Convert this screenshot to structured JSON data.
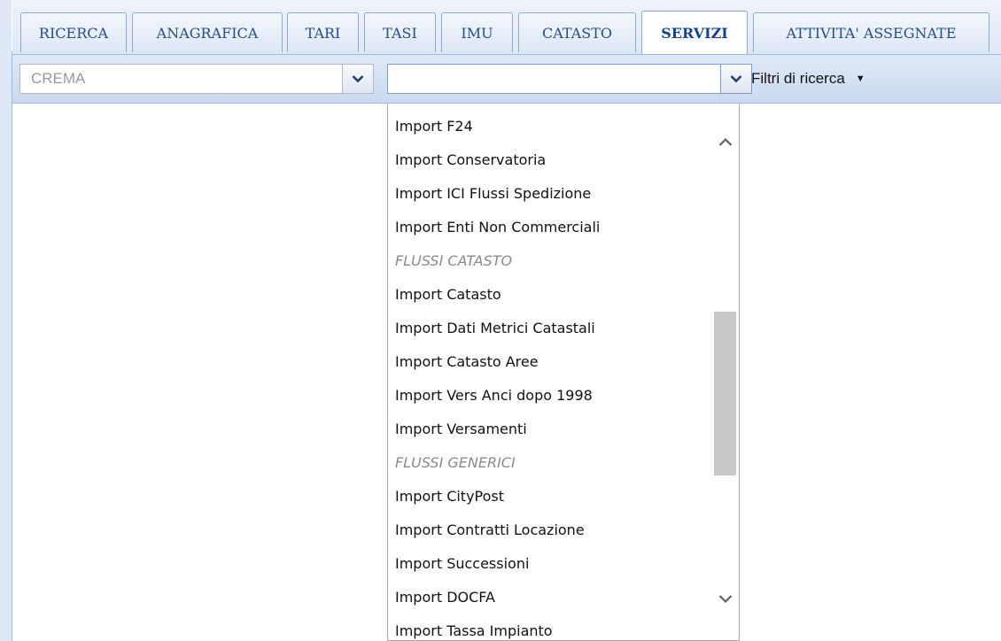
{
  "tabs": [
    {
      "label": "RICERCA"
    },
    {
      "label": "ANAGRAFICA"
    },
    {
      "label": "TARI"
    },
    {
      "label": "TASI"
    },
    {
      "label": "IMU"
    },
    {
      "label": "CATASTO"
    },
    {
      "label": "SERVIZI"
    },
    {
      "label": "ATTIVITA' ASSEGNATE"
    }
  ],
  "active_tab": "SERVIZI",
  "toolbar": {
    "municipality_value": "CREMA",
    "service_value": "",
    "filters_label": "Filtri di ricerca"
  },
  "dropdown": {
    "options": [
      {
        "label": "Import F24",
        "type": "item"
      },
      {
        "label": "Import Conservatoria",
        "type": "item"
      },
      {
        "label": "Import ICI Flussi Spedizione",
        "type": "item"
      },
      {
        "label": "Import Enti Non Commerciali",
        "type": "item"
      },
      {
        "label": "FLUSSI CATASTO",
        "type": "group"
      },
      {
        "label": "Import Catasto",
        "type": "item"
      },
      {
        "label": "Import Dati Metrici Catastali",
        "type": "item"
      },
      {
        "label": "Import Catasto Aree",
        "type": "item"
      },
      {
        "label": "Import Vers Anci dopo 1998",
        "type": "item"
      },
      {
        "label": "Import Versamenti",
        "type": "item"
      },
      {
        "label": "FLUSSI GENERICI",
        "type": "group"
      },
      {
        "label": "Import CityPost",
        "type": "item"
      },
      {
        "label": "Import Contratti Locazione",
        "type": "item"
      },
      {
        "label": "Import Successioni",
        "type": "item"
      },
      {
        "label": "Import DOCFA",
        "type": "item"
      },
      {
        "label": "Import Tassa Impianto",
        "type": "item"
      }
    ],
    "scroll_position": 0.55
  },
  "colors": {
    "accent": "#15428b",
    "tab_border": "#8eaad0",
    "panel_bg": "#dfe8f6",
    "group_label": "#8a8a8a"
  },
  "icons": {
    "combo_trigger": "chevron-down-icon",
    "filters_caret": "caret-down-icon",
    "scroll_up": "chevron-up-icon",
    "scroll_down": "chevron-down-icon"
  }
}
